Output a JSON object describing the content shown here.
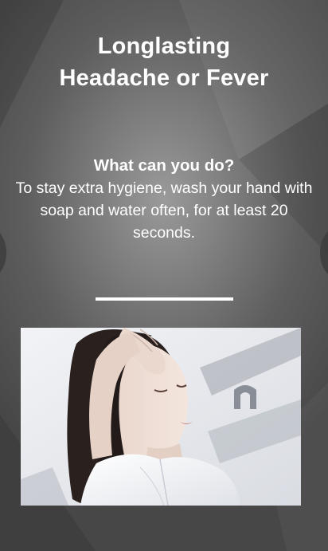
{
  "slide": {
    "title_line1": "Longlasting",
    "title_line2": "Headache or Fever",
    "heading": "What can you do?",
    "body": "To stay extra hygiene, wash your hand with soap and water often, for at least 20 seconds."
  },
  "colors": {
    "text": "#ffffff",
    "background_center": "#9a9a9a",
    "background_edge": "#474747",
    "divider": "#ffffff"
  },
  "icons": {
    "prev": "chevron-left-icon",
    "next": "chevron-right-icon"
  }
}
